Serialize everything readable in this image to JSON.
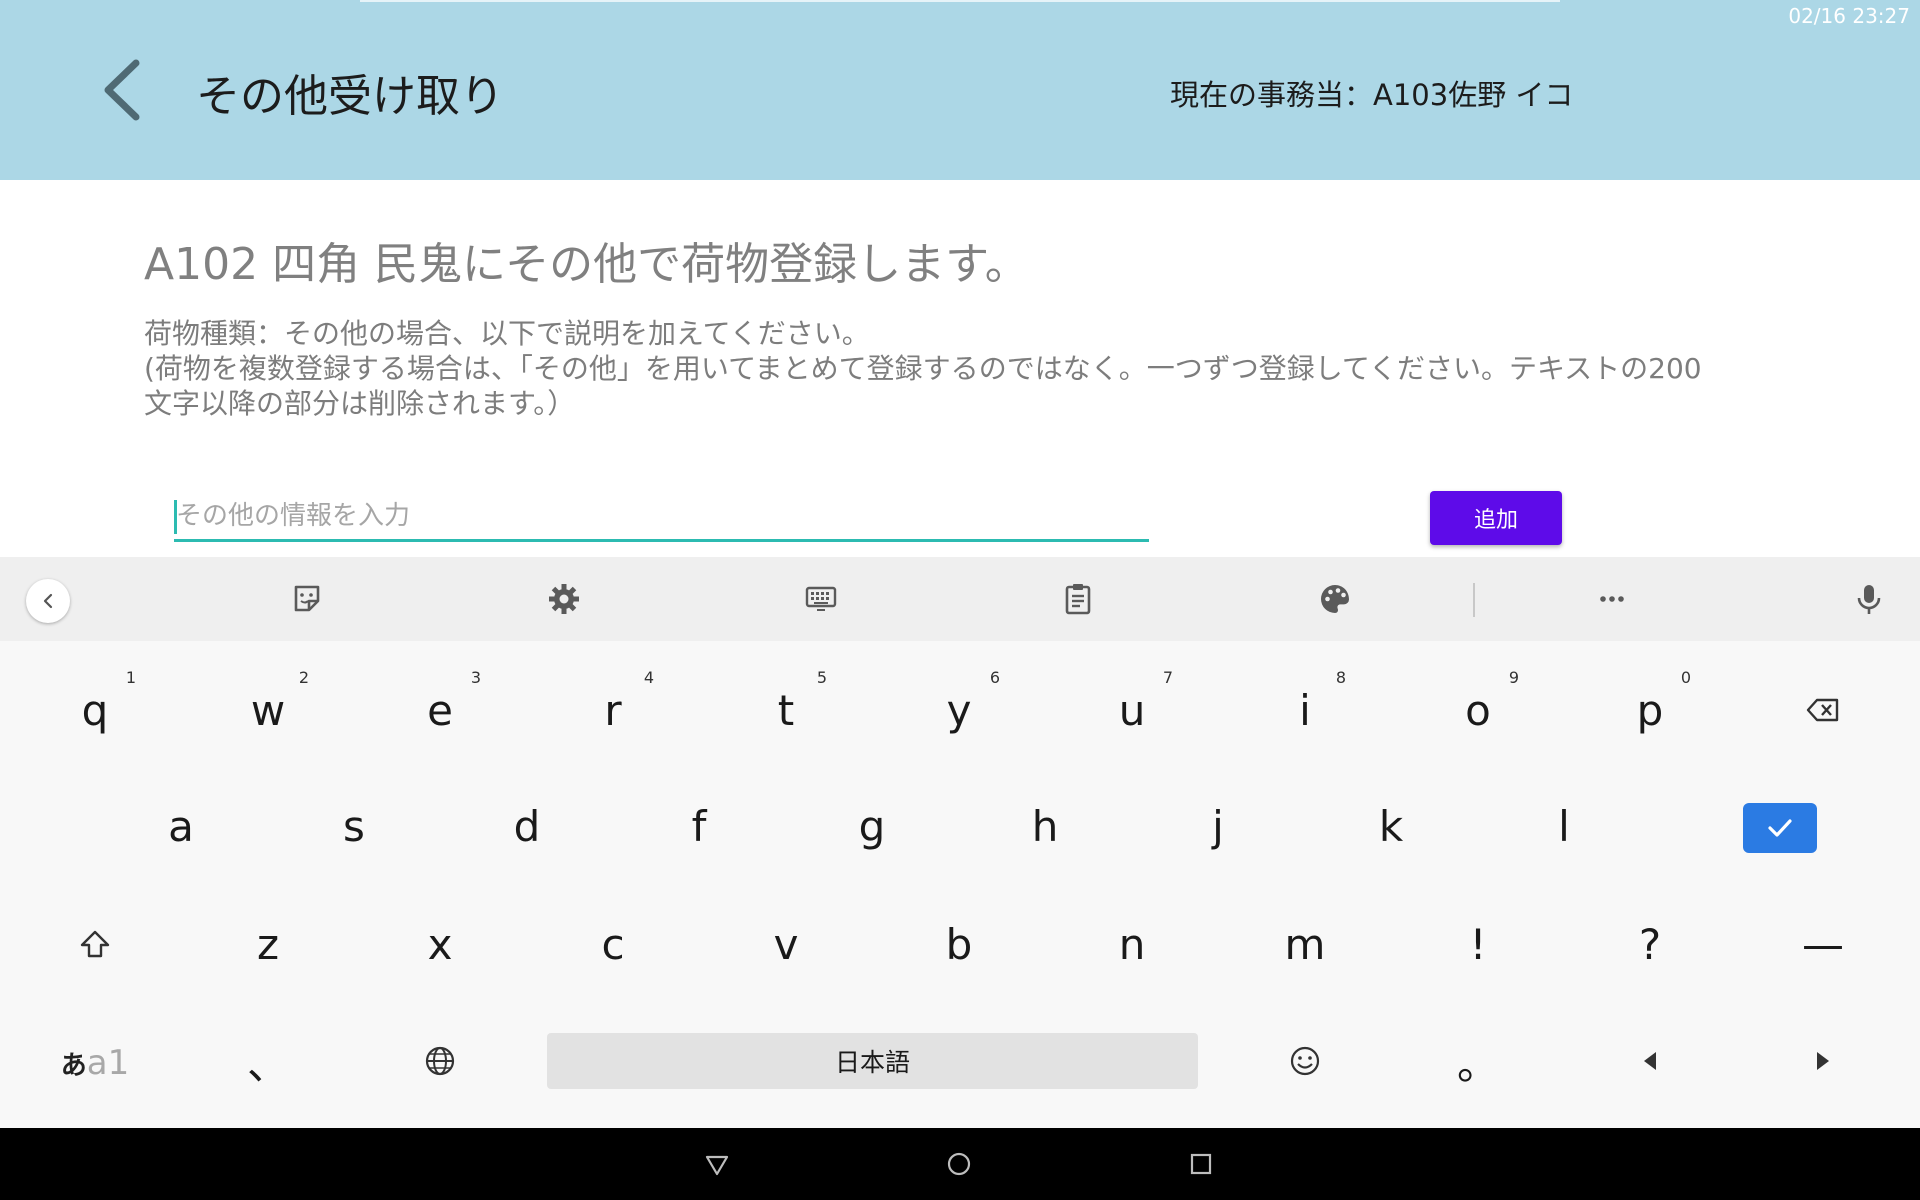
{
  "status_bar": {
    "time": "02/16 23:27"
  },
  "header": {
    "title": "その他受け取り",
    "current_staff": "現在の事務当：A103佐野 イコ",
    "back_icon": "chevron-left-icon"
  },
  "main": {
    "headline": "A102 四角 民鬼にその他で荷物登録します。",
    "description_lines": [
      "荷物種類：その他の場合、以下で説明を加えてください。",
      "(荷物を複数登録する場合は、「その他」を用いてまとめて登録するのではなく。一つずつ登録してください。テキストの200",
      "文字以降の部分は削除されます。）"
    ],
    "input": {
      "placeholder": "その他の情報を入力",
      "value": ""
    },
    "add_button": "追加"
  },
  "colors": {
    "header_bg": "#acd7e6",
    "accent_teal": "#2cbbb1",
    "add_button_bg": "#5e0be9",
    "enter_key_bg": "#2b7be3"
  },
  "keyboard": {
    "toolbar_icons": [
      "collapse-icon",
      "sticker-icon",
      "settings-icon",
      "keyboard-icon",
      "clipboard-icon",
      "palette-icon",
      "more-icon",
      "mic-icon"
    ],
    "row1": [
      {
        "label": "q",
        "hint": "1"
      },
      {
        "label": "w",
        "hint": "2"
      },
      {
        "label": "e",
        "hint": "3"
      },
      {
        "label": "r",
        "hint": "4"
      },
      {
        "label": "t",
        "hint": "5"
      },
      {
        "label": "y",
        "hint": "6"
      },
      {
        "label": "u",
        "hint": "7"
      },
      {
        "label": "i",
        "hint": "8"
      },
      {
        "label": "o",
        "hint": "9"
      },
      {
        "label": "p",
        "hint": "0"
      }
    ],
    "row2": [
      "a",
      "s",
      "d",
      "f",
      "g",
      "h",
      "j",
      "k",
      "l"
    ],
    "row3": [
      "z",
      "x",
      "c",
      "v",
      "b",
      "n",
      "m",
      "!",
      "?",
      "—"
    ],
    "row4": {
      "mode_a": "あ",
      "mode_b": "a1",
      "comma": "、",
      "space": "日本語",
      "period": "。"
    }
  }
}
